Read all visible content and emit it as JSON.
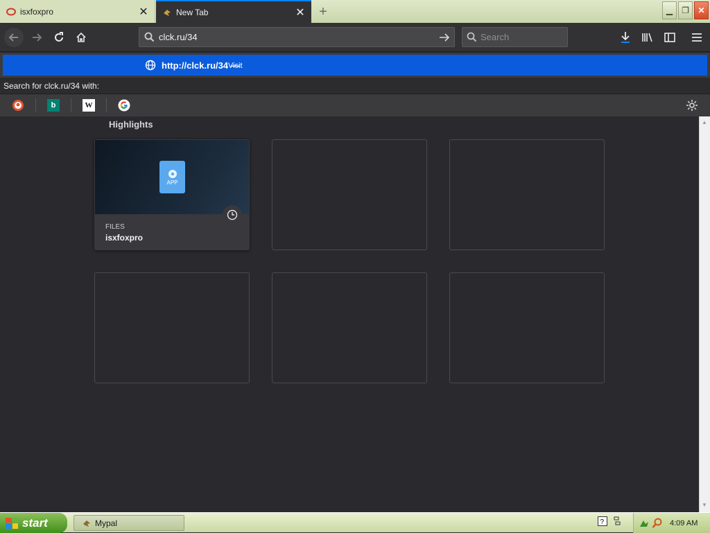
{
  "tabs": [
    {
      "title": "isxfoxpro",
      "active": false
    },
    {
      "title": "New Tab",
      "active": true
    }
  ],
  "navbar": {
    "url": "clck.ru/34",
    "search_placeholder": "Search"
  },
  "dropdown": {
    "suggestion_url": "http://clck.ru/34",
    "suggestion_separator": "—",
    "suggestion_action": "Visit",
    "search_with_label": "Search for clck.ru/34 with:",
    "engines": [
      "duckduckgo-icon",
      "bing-icon",
      "wikipedia-icon",
      "google-icon"
    ]
  },
  "content": {
    "highlights_title": "Highlights",
    "cards": [
      {
        "context": "FILES",
        "title": "isxfoxpro",
        "icon_label": "APP"
      }
    ]
  },
  "taskbar": {
    "start_label": "start",
    "task_item": "Mypal",
    "clock": "4:09 AM"
  },
  "colors": {
    "accent": "#0a84ff",
    "suggestion_bg": "#0a5cdc",
    "page_bg": "#2a2a2e"
  }
}
